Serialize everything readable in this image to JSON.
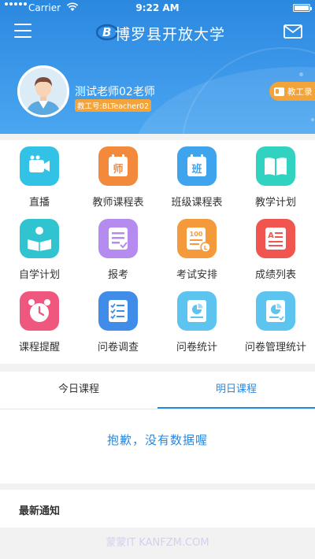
{
  "status_bar": {
    "carrier": "Carrier",
    "time": "9:22 AM"
  },
  "nav": {
    "title": "博罗县开放大学",
    "menu_icon": "hamburger-menu-icon",
    "mail_icon": "mail-icon"
  },
  "profile": {
    "name": "测试老师02老师",
    "id_label": "教工号:BLTeacher02",
    "id_card_button": "教工录"
  },
  "grid": {
    "items": [
      {
        "label": "直播",
        "icon": "video-camera-icon",
        "color": "#31c2e6"
      },
      {
        "label": "教师课程表",
        "icon": "teacher-schedule-icon",
        "color": "#f3893a"
      },
      {
        "label": "班级课程表",
        "icon": "class-schedule-icon",
        "color": "#3fa4ee"
      },
      {
        "label": "教学计划",
        "icon": "book-icon",
        "color": "#31d3c0"
      },
      {
        "label": "自学计划",
        "icon": "self-study-icon",
        "color": "#2fc4cf"
      },
      {
        "label": "报考",
        "icon": "registration-icon",
        "color": "#b68bf0"
      },
      {
        "label": "考试安排",
        "icon": "exam-schedule-icon",
        "color": "#f49a3a"
      },
      {
        "label": "成绩列表",
        "icon": "grade-list-icon",
        "color": "#f0554f"
      },
      {
        "label": "课程提醒",
        "icon": "alarm-clock-icon",
        "color": "#f0577f"
      },
      {
        "label": "问卷调查",
        "icon": "survey-checklist-icon",
        "color": "#3f8de8"
      },
      {
        "label": "问卷统计",
        "icon": "survey-stats-icon",
        "color": "#5cc4ee"
      },
      {
        "label": "问卷管理统计",
        "icon": "survey-manage-stats-icon",
        "color": "#5cc4ee"
      }
    ]
  },
  "course_tabs": {
    "today": "今日课程",
    "tomorrow": "明日课程",
    "active": "tomorrow",
    "empty_message": "抱歉，没有数据喔"
  },
  "notice": {
    "title": "最新通知"
  },
  "watermark": "蒙蒙IT KANFZM.COM",
  "colors": {
    "primary": "#2a88de",
    "accent": "#f2a33a"
  }
}
